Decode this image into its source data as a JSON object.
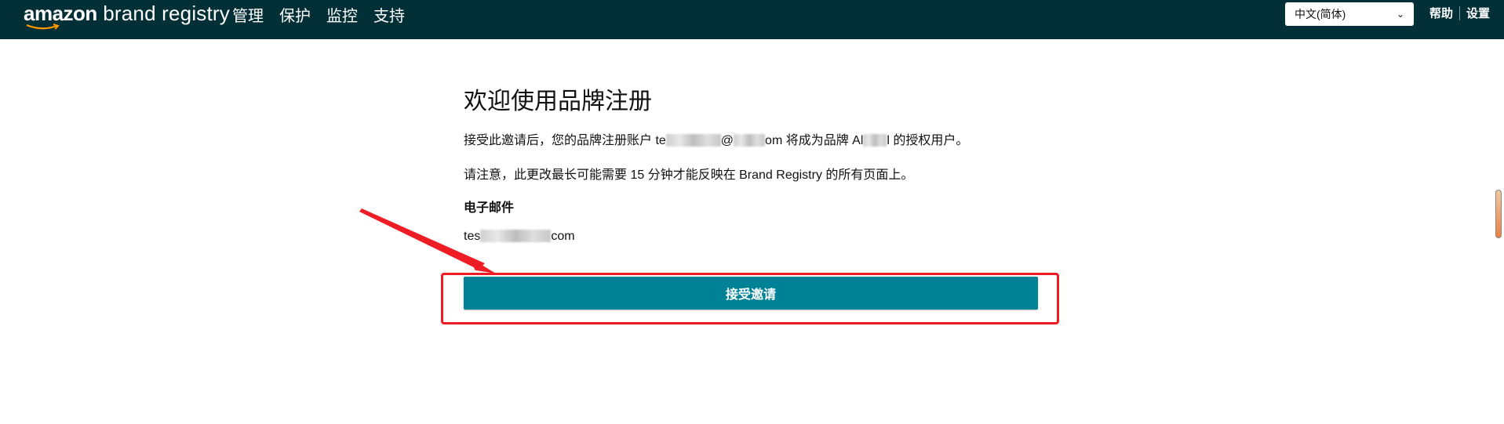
{
  "header": {
    "logo_amazon": "amazon",
    "logo_rest": " brand registry",
    "nav": [
      {
        "label": "管理"
      },
      {
        "label": "保护"
      },
      {
        "label": "监控"
      },
      {
        "label": "支持"
      }
    ],
    "language_select": {
      "value": "中文(简体)"
    },
    "help_label": "帮助",
    "settings_label": "设置"
  },
  "main": {
    "title": "欢迎使用品牌注册",
    "intro_part1": "接受此邀请后，您的品牌注册账户 te",
    "intro_part2": "@",
    "intro_part3": "om 将成为品牌 Al",
    "intro_part4": "l 的授权用户。",
    "note": "请注意，此更改最长可能需要 15 分钟才能反映在 Brand Registry 的所有页面上。",
    "email_label": "电子邮件",
    "email_prefix": "tes",
    "email_suffix": "com",
    "accept_button": "接受邀请"
  },
  "annotation": {
    "color": "#ee1c24"
  },
  "colors": {
    "header_bg": "#032f36",
    "button_bg": "#008296"
  }
}
